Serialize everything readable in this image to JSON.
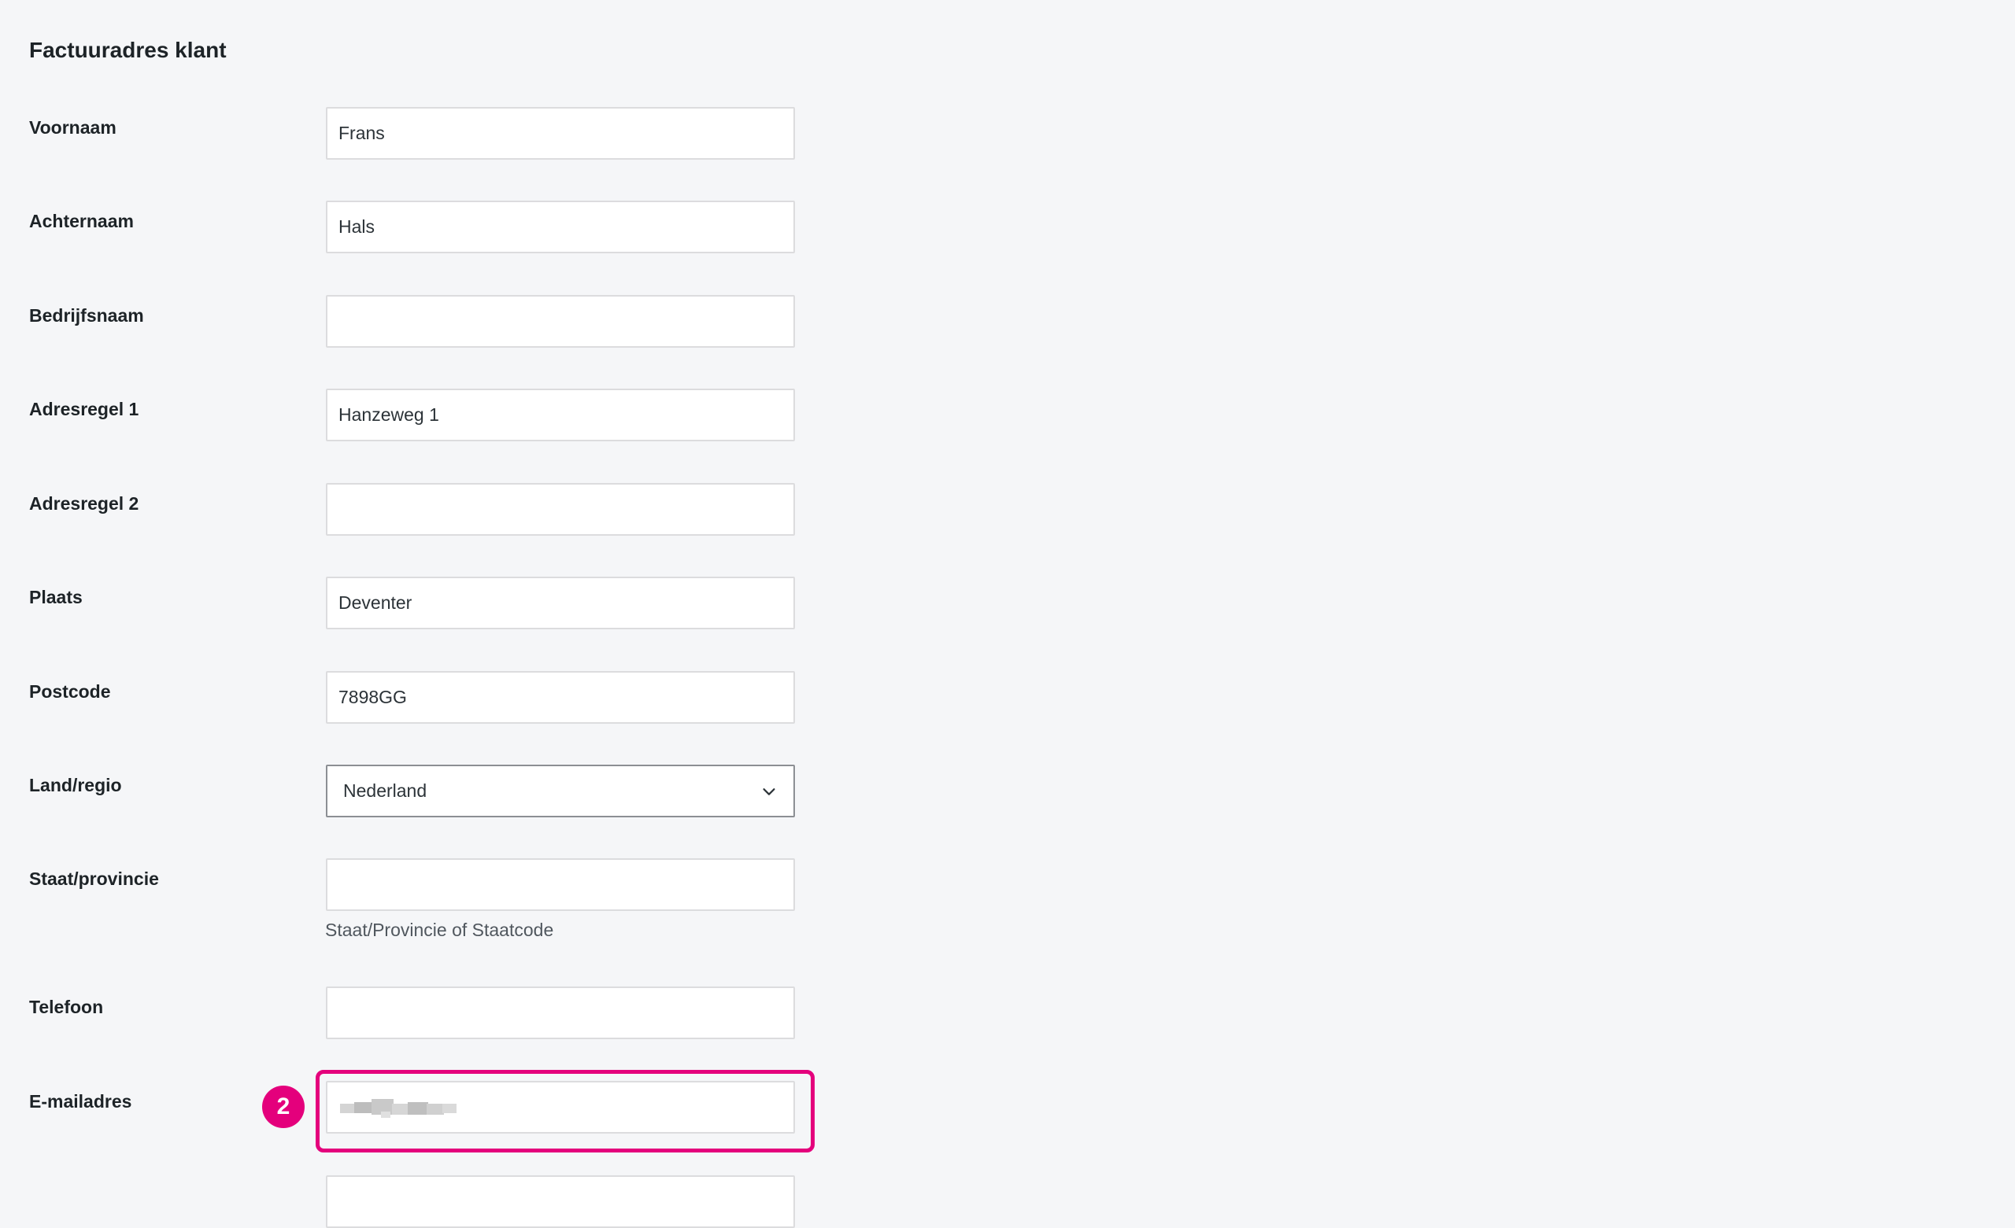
{
  "section": {
    "title": "Factuuradres klant"
  },
  "fields": {
    "voornaam": {
      "label": "Voornaam",
      "value": "Frans"
    },
    "achternaam": {
      "label": "Achternaam",
      "value": "Hals"
    },
    "bedrijf": {
      "label": "Bedrijfsnaam",
      "value": ""
    },
    "adres1": {
      "label": "Adresregel 1",
      "value": "Hanzeweg 1"
    },
    "adres2": {
      "label": "Adresregel 2",
      "value": ""
    },
    "plaats": {
      "label": "Plaats",
      "value": "Deventer"
    },
    "postcode": {
      "label": "Postcode",
      "value": "7898GG"
    },
    "land": {
      "label": "Land/regio",
      "value": "Nederland"
    },
    "staat": {
      "label": "Staat/provincie",
      "value": "",
      "description": "Staat/Provincie of Staatcode"
    },
    "telefoon": {
      "label": "Telefoon",
      "value": ""
    },
    "email": {
      "label": "E-mailadres",
      "value": ""
    }
  },
  "annotation": {
    "badge": "2",
    "color": "#e4007c"
  },
  "icons": {
    "select_arrow": "chevron-down-icon"
  }
}
